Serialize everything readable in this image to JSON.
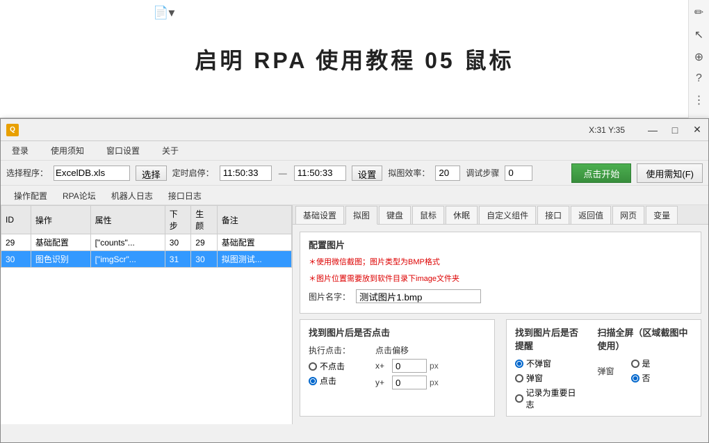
{
  "preview": {
    "title": "启明 RPA 使用教程  05  鼠标"
  },
  "window": {
    "icon": "Q",
    "coords": "X:31  Y:35",
    "controls": [
      "—",
      "□",
      "×"
    ]
  },
  "menubar": {
    "items": [
      "登录",
      "使用须知",
      "窗口设置",
      "关于"
    ]
  },
  "toolbar": {
    "select_program_label": "选择程序：",
    "program_value": "ExcelDB.xls",
    "select_btn": "选择",
    "timer_stop_label": "定时启停：",
    "time1": "11:50:33",
    "separator": "—",
    "time2": "11:50:33",
    "settings_btn": "设置",
    "find_efficiency_label": "拟图效率：",
    "find_efficiency_value": "20",
    "debug_step_label": "调试步骤",
    "debug_step_value": "0",
    "start_btn": "点击开始",
    "help_btn": "使用需知(F)"
  },
  "operation_tabs": {
    "items": [
      "操作配置",
      "RPA论坛",
      "机器人日志",
      "接口日志"
    ]
  },
  "table": {
    "headers": [
      "ID",
      "操作",
      "属性",
      "下步",
      "生\n颜",
      "备注"
    ],
    "rows": [
      {
        "id": "29",
        "op": "基础配置",
        "attr": "[\"counts\"...",
        "next": "30",
        "result": "29",
        "note": "基础配置",
        "selected": false
      },
      {
        "id": "30",
        "op": "图色识别",
        "attr": "[\"imgScr\"...",
        "next": "31",
        "result": "30",
        "note": "拟图测试...",
        "selected": true
      }
    ]
  },
  "config_tabs": {
    "items": [
      "基础设置",
      "拟图",
      "键盘",
      "鼠标",
      "休眠",
      "自定义组件",
      "接口",
      "返回值",
      "网页",
      "变量"
    ],
    "active": "拟图"
  },
  "config_image": {
    "section_title": "配置图片",
    "note1": "＊使用微信截图；图片类型为BMP格式",
    "note2": "＊图片位置需要放到软件目录下image文件夹",
    "image_name_label": "图片名字：",
    "image_name_value": "测试图片1.bmp"
  },
  "find_click": {
    "section_title": "找到图片后是否点击",
    "execute_label": "执行点击：",
    "no_click": "不点击",
    "click": "点击",
    "click_checked": true,
    "offset_section": "点击偏移",
    "x_label": "x+",
    "x_value": "0",
    "x_unit": "px",
    "y_label": "y+",
    "y_value": "0",
    "y_unit": "px"
  },
  "find_popup": {
    "section_title": "找到图片后是否提醒",
    "no_popup": "不弹窗",
    "popup": "弹窗",
    "log": "记录为重要日志",
    "no_popup_checked": true
  },
  "scan": {
    "section_title": "扫描全屏（区域截图中使用）",
    "popup_label": "弹窗",
    "yes": "是",
    "no": "否",
    "no_checked": true
  }
}
